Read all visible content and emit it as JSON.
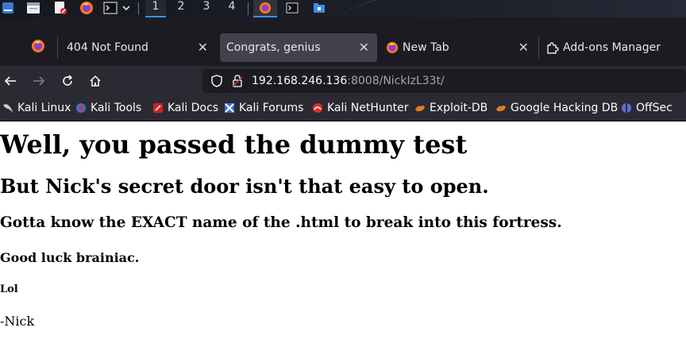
{
  "taskbar": {
    "workspaces": [
      "1",
      "2",
      "3",
      "4"
    ],
    "active_workspace": "1",
    "icons": [
      "kali-menu-icon",
      "file-manager-icon",
      "text-editor-icon",
      "firefox-icon",
      "terminal-icon",
      "chevron-down-icon"
    ],
    "window_buttons": [
      "firefox-window-icon",
      "terminal-window-icon",
      "folder-window-icon"
    ]
  },
  "tabs": [
    {
      "label": "",
      "icon": "firefox-icon",
      "closable": false
    },
    {
      "label": "404 Not Found",
      "icon": "",
      "closable": true
    },
    {
      "label": "Congrats, genius",
      "icon": "",
      "closable": true,
      "selected": true
    },
    {
      "label": "New Tab",
      "icon": "firefox-icon",
      "closable": true
    },
    {
      "label": "Add-ons Manager",
      "icon": "puzzle-icon",
      "closable": false
    }
  ],
  "nav": {
    "back": "←",
    "forward": "→",
    "reload": "↻",
    "home": "⌂",
    "url_host": "192.168.246.136",
    "url_rest": ":8008/NickIzL33t/"
  },
  "bookmarks": [
    {
      "label": "Kali Linux",
      "color": "#8a8a8a"
    },
    {
      "label": "Kali Tools",
      "color": "#d9302b"
    },
    {
      "label": "Kali Docs",
      "color": "#c8262b"
    },
    {
      "label": "Kali Forums",
      "color": "#3b6fd8"
    },
    {
      "label": "Kali NetHunter",
      "color": "#d9302b"
    },
    {
      "label": "Exploit-DB",
      "color": "#e07b22"
    },
    {
      "label": "Google Hacking DB",
      "color": "#e07b22"
    },
    {
      "label": "OffSec",
      "color": "#5b6fd6"
    }
  ],
  "page": {
    "h1": "Well, you passed the dummy test",
    "h2": "But Nick's secret door isn't that easy to open.",
    "h3": "Gotta know the EXACT name of the .html to break into this fortress.",
    "h4": "Good luck brainiac.",
    "h5": "Lol",
    "signature": "-Nick"
  },
  "colors": {
    "chrome_dark": "#1c1b22",
    "toolbar": "#2b2a33",
    "selected_tab": "#42414d",
    "accent": "#3d8fe3"
  }
}
